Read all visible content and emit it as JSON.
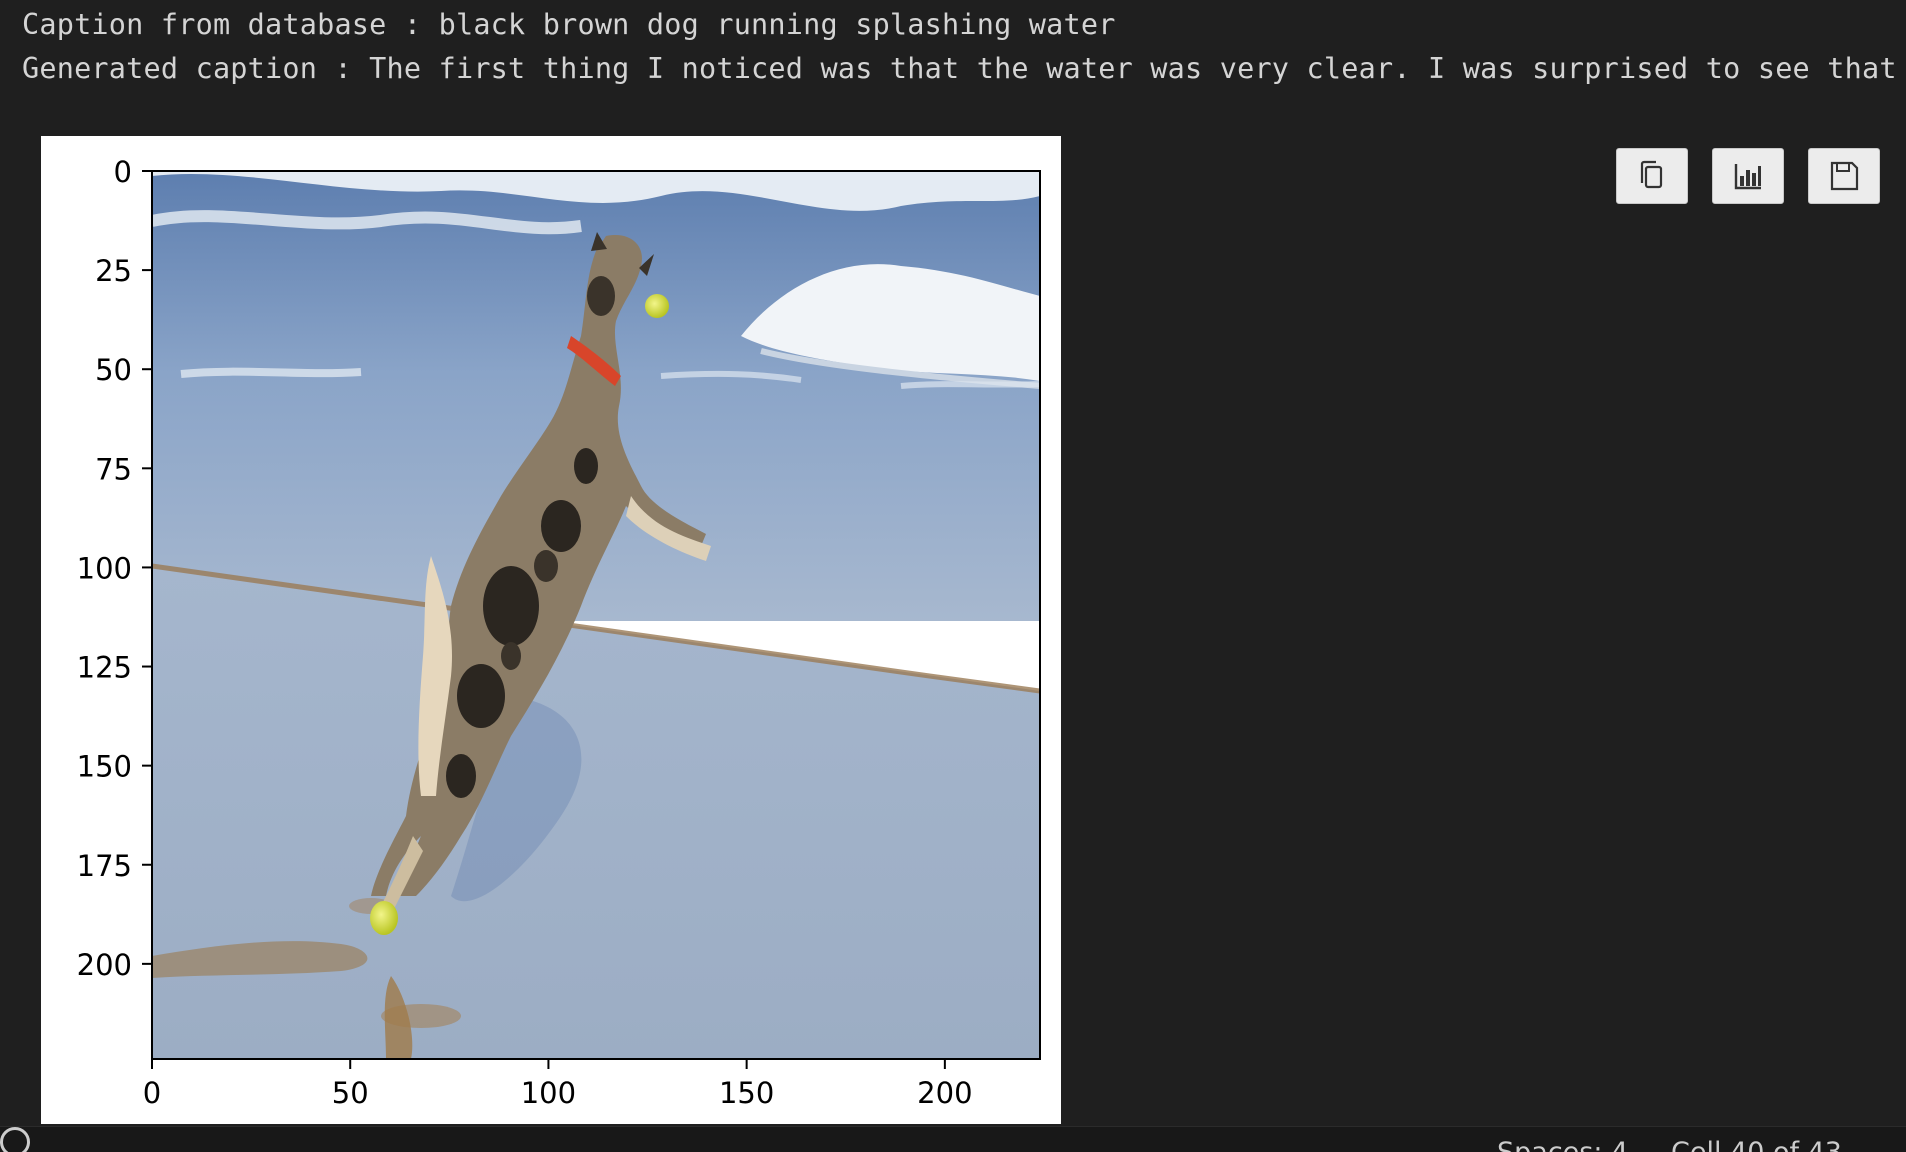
{
  "output": {
    "caption_database_line": "Caption from database : black brown dog running splashing water",
    "generated_caption_line": "Generated caption : The first thing I noticed was that the water was very clear. I was surprised to see that"
  },
  "output_toolbar": {
    "buttons": [
      {
        "icon": "copy-icon"
      },
      {
        "icon": "bar-chart-icon"
      },
      {
        "icon": "save-icon"
      }
    ]
  },
  "statusbar": {
    "spaces": "Spaces: 4",
    "cell": "Cell 40 of 43",
    "notification_icon": "bell-icon"
  },
  "chart_data": {
    "type": "image",
    "image_subject": "black brown dog running splashing water",
    "xlim": [
      0,
      224
    ],
    "ylim": [
      224,
      0
    ],
    "x_ticks": [
      "0",
      "50",
      "100",
      "150",
      "200"
    ],
    "y_ticks": [
      "0",
      "25",
      "50",
      "75",
      "100",
      "125",
      "150",
      "175",
      "200"
    ],
    "x_tick_values": [
      0,
      50,
      100,
      150,
      200
    ],
    "y_tick_values": [
      0,
      25,
      50,
      75,
      100,
      125,
      150,
      175,
      200
    ],
    "grid": false,
    "colors": {
      "sea": "#7e9ac2",
      "wave_foam": "#e8eef5",
      "wet_sand": "#9fb0c8",
      "dog_fur": "#8a7b66",
      "dog_dark_patch": "#2b2620",
      "collar": "#d8452a",
      "ball": "#d8e040"
    }
  }
}
